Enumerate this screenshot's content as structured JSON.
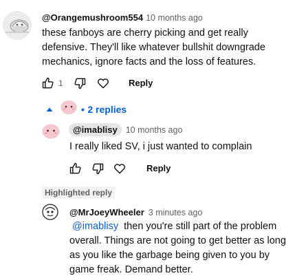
{
  "comment": {
    "author": "@Orangemushroom554",
    "time": "10 months ago",
    "lines": [
      "these fanboys are cherry picking and get really",
      "defensive. They'll like whatever bullshit downgrade",
      "mechanics, ignore facts and the loss of features."
    ],
    "like_count": "1",
    "reply_label": "Reply"
  },
  "replies_toggle": {
    "bullet": "•",
    "label": "2 replies"
  },
  "reply1": {
    "author": "@imablisy",
    "time": "10 months ago",
    "text": "I really liked SV, i just wanted to complain",
    "reply_label": "Reply"
  },
  "highlighted": {
    "label": "Highlighted reply"
  },
  "reply2": {
    "author": "@MrJoeyWheeler",
    "time": "3 minutes ago",
    "mention": "@imablisy",
    "lines": [
      "then you're still part of the problem",
      "overall. Things are not going to get better as long",
      "as you like the garbage being given to you by",
      "game freak. Demand better."
    ]
  },
  "colors": {
    "link": "#065fd4",
    "text": "#0f0f0f",
    "meta": "#606060",
    "chip": "#e5e5e5",
    "avatar_pink": "#f7c8cf"
  },
  "icons": [
    "like-icon",
    "dislike-icon",
    "heart-icon",
    "caret-up-icon"
  ]
}
